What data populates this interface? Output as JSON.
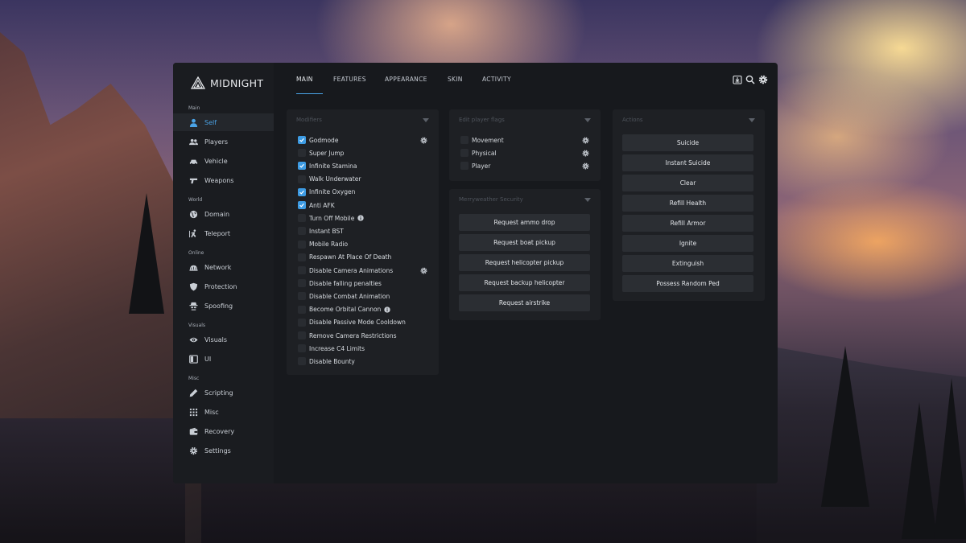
{
  "app": {
    "title": "MIDNIGHT"
  },
  "colors": {
    "accent": "#4aa3e6",
    "window_bg": "#17191d",
    "panel_bg": "#1e2024",
    "button_bg": "#2b2e33"
  },
  "sidebar": {
    "sections": [
      {
        "label": "Main",
        "items": [
          {
            "label": "Self",
            "icon": "user-icon",
            "active": true
          },
          {
            "label": "Players",
            "icon": "users-icon"
          },
          {
            "label": "Vehicle",
            "icon": "car-icon"
          },
          {
            "label": "Weapons",
            "icon": "gun-icon"
          }
        ]
      },
      {
        "label": "World",
        "items": [
          {
            "label": "Domain",
            "icon": "globe-icon"
          },
          {
            "label": "Teleport",
            "icon": "running-icon"
          }
        ]
      },
      {
        "label": "Online",
        "items": [
          {
            "label": "Network",
            "icon": "network-icon"
          },
          {
            "label": "Protection",
            "icon": "shield-icon"
          },
          {
            "label": "Spoofing",
            "icon": "spy-icon"
          }
        ]
      },
      {
        "label": "Visuals",
        "items": [
          {
            "label": "Visuals",
            "icon": "eye-icon"
          },
          {
            "label": "UI",
            "icon": "window-icon"
          }
        ]
      },
      {
        "label": "Misc",
        "items": [
          {
            "label": "Scripting",
            "icon": "pen-icon"
          },
          {
            "label": "Misc",
            "icon": "grid-icon"
          },
          {
            "label": "Recovery",
            "icon": "wallet-icon"
          },
          {
            "label": "Settings",
            "icon": "gear-icon"
          }
        ]
      }
    ]
  },
  "tabs": [
    {
      "label": "MAIN",
      "active": true
    },
    {
      "label": "FEATURES"
    },
    {
      "label": "APPEARANCE"
    },
    {
      "label": "SKIN"
    },
    {
      "label": "ACTIVITY"
    }
  ],
  "top_icons": [
    "download-icon",
    "search-icon",
    "gear-icon"
  ],
  "modifiers": {
    "title": "Modifiers",
    "items": [
      {
        "label": "Godmode",
        "checked": true,
        "gear": true
      },
      {
        "label": "Super Jump",
        "checked": false
      },
      {
        "label": "Infinite Stamina",
        "checked": true
      },
      {
        "label": "Walk Underwater",
        "checked": false
      },
      {
        "label": "Infinite Oxygen",
        "checked": true
      },
      {
        "label": "Anti AFK",
        "checked": true
      },
      {
        "label": "Turn Off Mobile",
        "checked": false,
        "info": true
      },
      {
        "label": "Instant BST",
        "checked": false
      },
      {
        "label": "Mobile Radio",
        "checked": false
      },
      {
        "label": "Respawn At Place Of Death",
        "checked": false
      },
      {
        "label": "Disable Camera Animations",
        "checked": false,
        "gear": true
      },
      {
        "label": "Disable falling penalties",
        "checked": false
      },
      {
        "label": "Disable Combat Animation",
        "checked": false
      },
      {
        "label": "Become Orbital Cannon",
        "checked": false,
        "info": true
      },
      {
        "label": "Disable Passive Mode Cooldown",
        "checked": false
      },
      {
        "label": "Remove Camera Restrictions",
        "checked": false
      },
      {
        "label": "Increase C4 Limits",
        "checked": false
      },
      {
        "label": "Disable Bounty",
        "checked": false
      }
    ]
  },
  "player_flags": {
    "title": "Edit player flags",
    "items": [
      {
        "label": "Movement",
        "checked": false
      },
      {
        "label": "Physical",
        "checked": false
      },
      {
        "label": "Player",
        "checked": false
      }
    ]
  },
  "merryweather": {
    "title": "Merryweather Security",
    "buttons": [
      "Request ammo drop",
      "Request boat pickup",
      "Request helicopter pickup",
      "Request backup helicopter",
      "Request airstrike"
    ]
  },
  "actions": {
    "title": "Actions",
    "buttons": [
      "Suicide",
      "Instant Suicide",
      "Clear",
      "Refill Health",
      "Refill Armor",
      "Ignite",
      "Extinguish",
      "Possess Random Ped"
    ]
  }
}
